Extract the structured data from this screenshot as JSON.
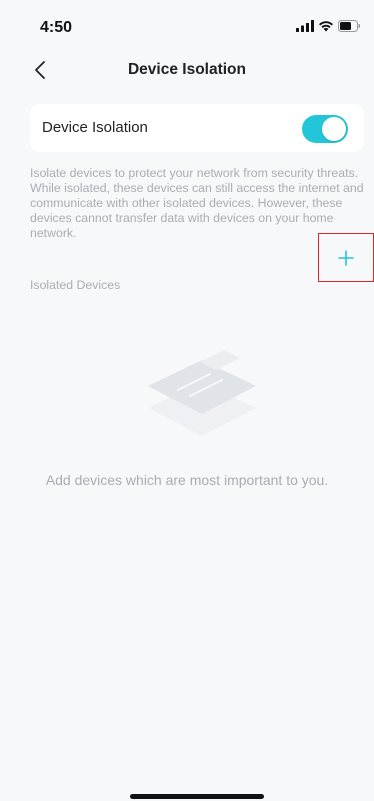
{
  "status_bar": {
    "time": "4:50"
  },
  "nav": {
    "title": "Device Isolation"
  },
  "isolation_card": {
    "label": "Device Isolation",
    "enabled": true
  },
  "description": "Isolate devices to protect your network from security threats. While isolated, these devices can still access the internet and communicate with other isolated devices. However, these devices cannot transfer data with devices on your home network.",
  "isolated_devices": {
    "section_label": "Isolated Devices",
    "add_symbol": "+",
    "empty_message": "Add devices which are most important to you."
  },
  "colors": {
    "accent": "#23c6d8",
    "highlight_border": "#d8262a",
    "background": "#f7f8fa",
    "muted_text": "#a9adb3"
  },
  "icons": [
    "signal-icon",
    "wifi-icon",
    "battery-icon",
    "back-chevron-icon",
    "add-icon",
    "empty-devices-illustration"
  ]
}
